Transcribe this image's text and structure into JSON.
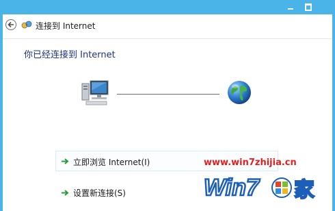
{
  "window": {
    "title": "连接到 Internet"
  },
  "content": {
    "heading": "你已经连接到 Internet"
  },
  "tasks": [
    {
      "label": "立即浏览 Internet(I)"
    },
    {
      "label": "设置新连接(S)"
    }
  ],
  "watermark": {
    "url": "www.win7zhijia.cn",
    "logo_text": "Win7之家"
  },
  "colors": {
    "frame": "#4ab3e8",
    "heading": "#1e3287",
    "watermark_red": "#e02020",
    "arrow_green": "#2a9d3a"
  },
  "icons": [
    "minimize-icon",
    "maximize-icon",
    "back-arrow-icon",
    "network-connection-icon",
    "computer-icon",
    "globe-icon",
    "green-arrow-icon"
  ]
}
